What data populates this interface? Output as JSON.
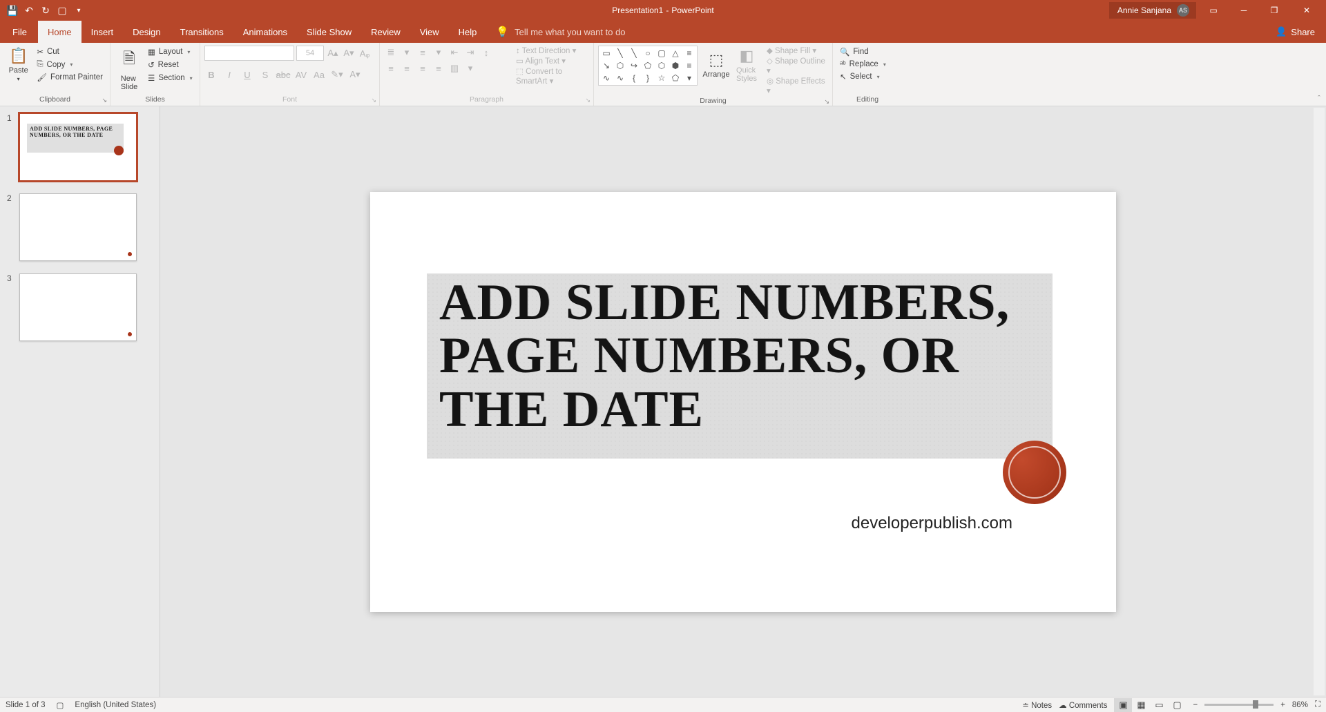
{
  "app": {
    "doc_title": "Presentation1",
    "app_name": "PowerPoint",
    "sep": " - "
  },
  "user": {
    "name": "Annie Sanjana",
    "initials": "AS"
  },
  "ribbon": {
    "tabs": [
      "File",
      "Home",
      "Insert",
      "Design",
      "Transitions",
      "Animations",
      "Slide Show",
      "Review",
      "View",
      "Help"
    ],
    "tell_me": "Tell me what you want to do",
    "share": "Share"
  },
  "clipboard": {
    "label": "Clipboard",
    "paste": "Paste",
    "cut": "Cut",
    "copy": "Copy",
    "format_painter": "Format Painter"
  },
  "slides_group": {
    "label": "Slides",
    "new_slide": "New\nSlide",
    "layout": "Layout",
    "reset": "Reset",
    "section": "Section"
  },
  "font_group": {
    "label": "Font",
    "size": "54"
  },
  "paragraph_group": {
    "label": "Paragraph",
    "text_direction": "Text Direction",
    "align_text": "Align Text",
    "smartart": "Convert to SmartArt"
  },
  "drawing_group": {
    "label": "Drawing",
    "arrange": "Arrange",
    "quick_styles": "Quick\nStyles",
    "fill": "Shape Fill",
    "outline": "Shape Outline",
    "effects": "Shape Effects"
  },
  "editing_group": {
    "label": "Editing",
    "find": "Find",
    "replace": "Replace",
    "select": "Select"
  },
  "thumbs": {
    "t1_title": "ADD SLIDE NUMBERS, PAGE NUMBERS, OR THE DATE"
  },
  "slide": {
    "title": "ADD SLIDE NUMBERS, PAGE NUMBERS, OR THE DATE",
    "url": "developerpublish.com"
  },
  "status": {
    "slide": "Slide 1 of 3",
    "lang": "English (United States)",
    "notes": "Notes",
    "comments": "Comments",
    "zoom": "86%"
  }
}
